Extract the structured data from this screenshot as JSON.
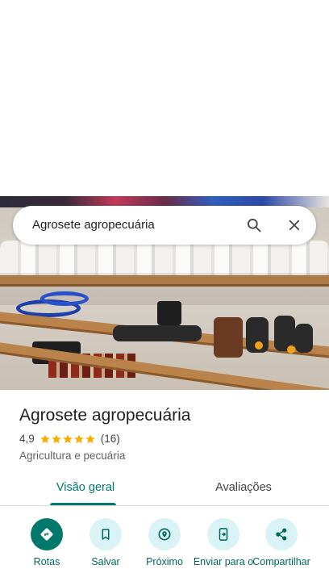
{
  "search": {
    "query": "Agrosete agropecuária",
    "search_icon": "search-icon",
    "close_icon": "close-icon"
  },
  "place": {
    "name": "Agrosete agropecuária",
    "rating": "4,9",
    "rating_value": 4.9,
    "stars_max": 5,
    "review_count": "(16)",
    "category": "Agricultura e pecuária"
  },
  "tabs": [
    {
      "label": "Visão geral",
      "active": true
    },
    {
      "label": "Avaliações",
      "active": false
    }
  ],
  "actions": [
    {
      "label": "Rotas",
      "icon": "directions-icon"
    },
    {
      "label": "Salvar",
      "icon": "bookmark-icon"
    },
    {
      "label": "Próximo",
      "icon": "nearby-icon"
    },
    {
      "label": "Enviar para o",
      "icon": "send-to-phone-icon"
    },
    {
      "label": "Compartilhar",
      "icon": "share-icon"
    }
  ],
  "colors": {
    "accent": "#00796b",
    "action_bg": "#d9f3f7",
    "star": "#f9ab00"
  }
}
